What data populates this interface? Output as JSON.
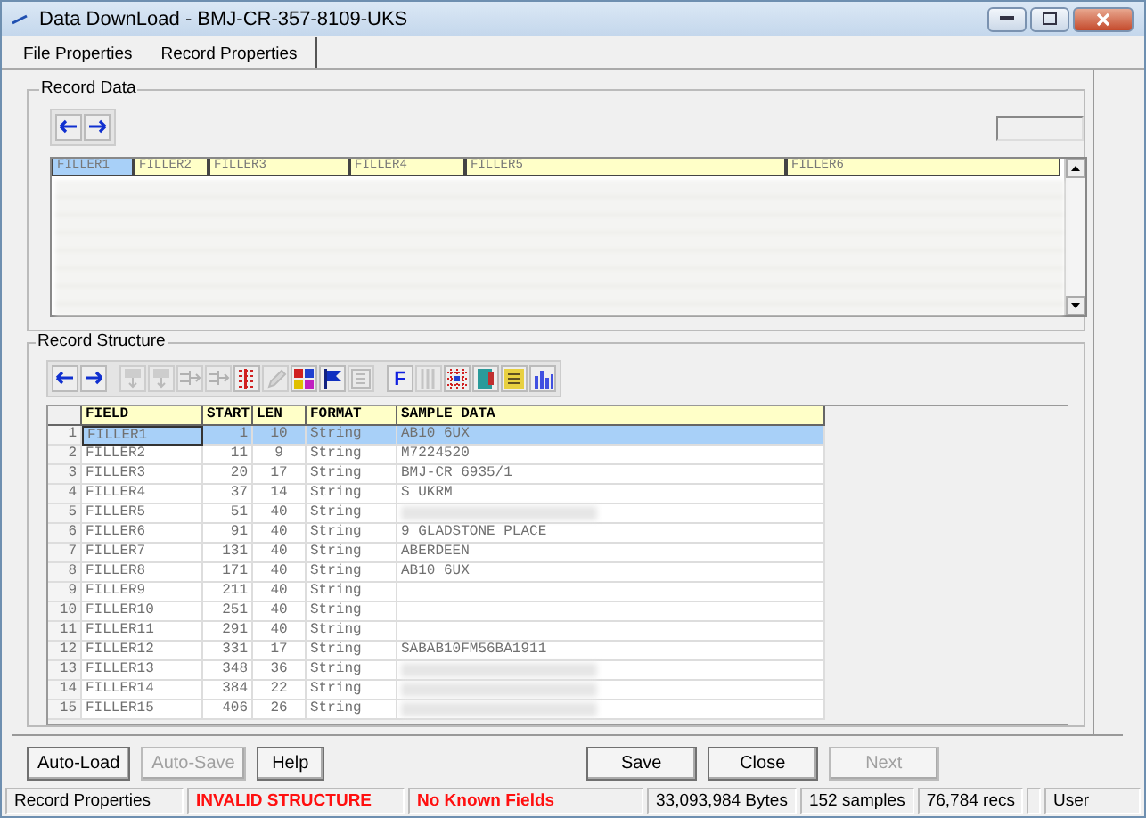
{
  "window": {
    "title": "Data DownLoad - BMJ-CR-357-8109-UKS"
  },
  "tabs": [
    {
      "label": "File Properties",
      "selected": false
    },
    {
      "label": "Record Properties",
      "selected": true
    }
  ],
  "record_data": {
    "title": "Record Data",
    "toolbar": [
      {
        "kind": "arrow-left"
      },
      {
        "kind": "arrow-right"
      }
    ],
    "columns": [
      {
        "label": "FILLER1",
        "selected": true
      },
      {
        "label": "FILLER2",
        "selected": false
      },
      {
        "label": "FILLER3",
        "selected": false
      },
      {
        "label": "FILLER4",
        "selected": false
      },
      {
        "label": "FILLER5",
        "selected": false
      },
      {
        "label": "FILLER6",
        "selected": false
      }
    ]
  },
  "record_structure": {
    "title": "Record Structure",
    "toolbar": [
      {
        "kind": "arrow-left",
        "disabled": false
      },
      {
        "kind": "arrow-right",
        "disabled": false
      },
      {
        "kind": "row-down",
        "disabled": true
      },
      {
        "kind": "row-down",
        "disabled": true
      },
      {
        "kind": "split",
        "disabled": true
      },
      {
        "kind": "split",
        "disabled": true
      },
      {
        "kind": "red-lines",
        "disabled": false
      },
      {
        "kind": "pencil",
        "disabled": true
      },
      {
        "kind": "color-blocks",
        "disabled": false
      },
      {
        "kind": "flag",
        "disabled": false
      },
      {
        "kind": "list-box",
        "disabled": true
      },
      {
        "kind": "letter",
        "label": "F",
        "disabled": false
      },
      {
        "kind": "columns",
        "disabled": true
      },
      {
        "kind": "red-grid",
        "disabled": false
      },
      {
        "kind": "book",
        "disabled": false
      },
      {
        "kind": "yellow-list",
        "disabled": false
      },
      {
        "kind": "bar-chart",
        "disabled": false
      }
    ],
    "columns": [
      "FIELD",
      "START",
      "LEN",
      "FORMAT",
      "SAMPLE DATA"
    ],
    "rows": [
      {
        "num": "1",
        "field": "FILLER1",
        "start": "1",
        "len": "10",
        "format": "String",
        "sample": "AB10 6UX",
        "selected": true
      },
      {
        "num": "2",
        "field": "FILLER2",
        "start": "11",
        "len": "9",
        "format": "String",
        "sample": "M7224520",
        "selected": false
      },
      {
        "num": "3",
        "field": "FILLER3",
        "start": "20",
        "len": "17",
        "format": "String",
        "sample": "BMJ-CR 6935/1",
        "selected": false
      },
      {
        "num": "4",
        "field": "FILLER4",
        "start": "37",
        "len": "14",
        "format": "String",
        "sample": "S UKRM",
        "selected": false
      },
      {
        "num": "5",
        "field": "FILLER5",
        "start": "51",
        "len": "40",
        "format": "String",
        "sample_blurred": true,
        "selected": false
      },
      {
        "num": "6",
        "field": "FILLER6",
        "start": "91",
        "len": "40",
        "format": "String",
        "sample": "9 GLADSTONE PLACE",
        "selected": false
      },
      {
        "num": "7",
        "field": "FILLER7",
        "start": "131",
        "len": "40",
        "format": "String",
        "sample": "ABERDEEN",
        "selected": false
      },
      {
        "num": "8",
        "field": "FILLER8",
        "start": "171",
        "len": "40",
        "format": "String",
        "sample": "AB10 6UX",
        "selected": false
      },
      {
        "num": "9",
        "field": "FILLER9",
        "start": "211",
        "len": "40",
        "format": "String",
        "selected": false
      },
      {
        "num": "10",
        "field": "FILLER10",
        "start": "251",
        "len": "40",
        "format": "String",
        "selected": false
      },
      {
        "num": "11",
        "field": "FILLER11",
        "start": "291",
        "len": "40",
        "format": "String",
        "selected": false
      },
      {
        "num": "12",
        "field": "FILLER12",
        "start": "331",
        "len": "17",
        "format": "String",
        "sample": "SABAB10FM56BA1911",
        "selected": false
      },
      {
        "num": "13",
        "field": "FILLER13",
        "start": "348",
        "len": "36",
        "format": "String",
        "sample_blurred": true,
        "selected": false
      },
      {
        "num": "14",
        "field": "FILLER14",
        "start": "384",
        "len": "22",
        "format": "String",
        "sample_blurred": true,
        "selected": false
      },
      {
        "num": "15",
        "field": "FILLER15",
        "start": "406",
        "len": "26",
        "format": "String",
        "sample_blurred": true,
        "selected": false
      }
    ]
  },
  "buttons": [
    {
      "label": "Auto-Load",
      "disabled": false
    },
    {
      "label": "Auto-Save",
      "disabled": true
    },
    {
      "label": "Help",
      "disabled": false
    },
    {
      "label": "Save",
      "disabled": false
    },
    {
      "label": "Close",
      "disabled": false
    },
    {
      "label": "Next",
      "disabled": true
    }
  ],
  "status_bar": [
    {
      "text": "Record Properties",
      "kind": "normal"
    },
    {
      "text": "INVALID STRUCTURE",
      "kind": "alert"
    },
    {
      "text": "No Known Fields",
      "kind": "alert"
    },
    {
      "text": "33,093,984 Bytes",
      "kind": "normal"
    },
    {
      "text": "152 samples",
      "kind": "normal"
    },
    {
      "text": "76,784 recs",
      "kind": "normal"
    },
    {
      "text": "User",
      "kind": "normal"
    }
  ]
}
